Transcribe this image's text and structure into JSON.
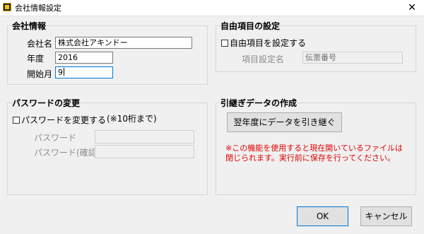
{
  "window": {
    "title": "会社情報設定",
    "close_glyph": "✕",
    "app_icon": "app-logo-icon"
  },
  "company_info": {
    "title": "会社情報",
    "company_name_label": "会社名",
    "company_name_value": "株式会社アキンドー",
    "year_label": "年度",
    "year_value": "2016",
    "start_month_label": "開始月",
    "start_month_value": "9"
  },
  "custom_field": {
    "title": "自由項目の設定",
    "checkbox_label": "自由項目を設定する",
    "checked": false,
    "field_name_label": "項目設定名",
    "field_name_value": "伝票番号"
  },
  "password": {
    "title": "パスワードの変更",
    "checkbox_label": "パスワードを変更する",
    "checked": false,
    "hint": "(※10桁まで)",
    "password_label": "パスワード",
    "confirm_label": "パスワード(確認)",
    "password_value": "",
    "confirm_value": ""
  },
  "carryover": {
    "title": "引継ぎデータの作成",
    "button_label": "翌年度にデータを引き継ぐ",
    "warning_line1": "※この機能を使用すると現在開いているファイルは",
    "warning_line2": "閉じられます。実行前に保存を行ってください。",
    "warning_color": "#e00000"
  },
  "footer": {
    "ok_label": "OK",
    "cancel_label": "キャンセル"
  }
}
